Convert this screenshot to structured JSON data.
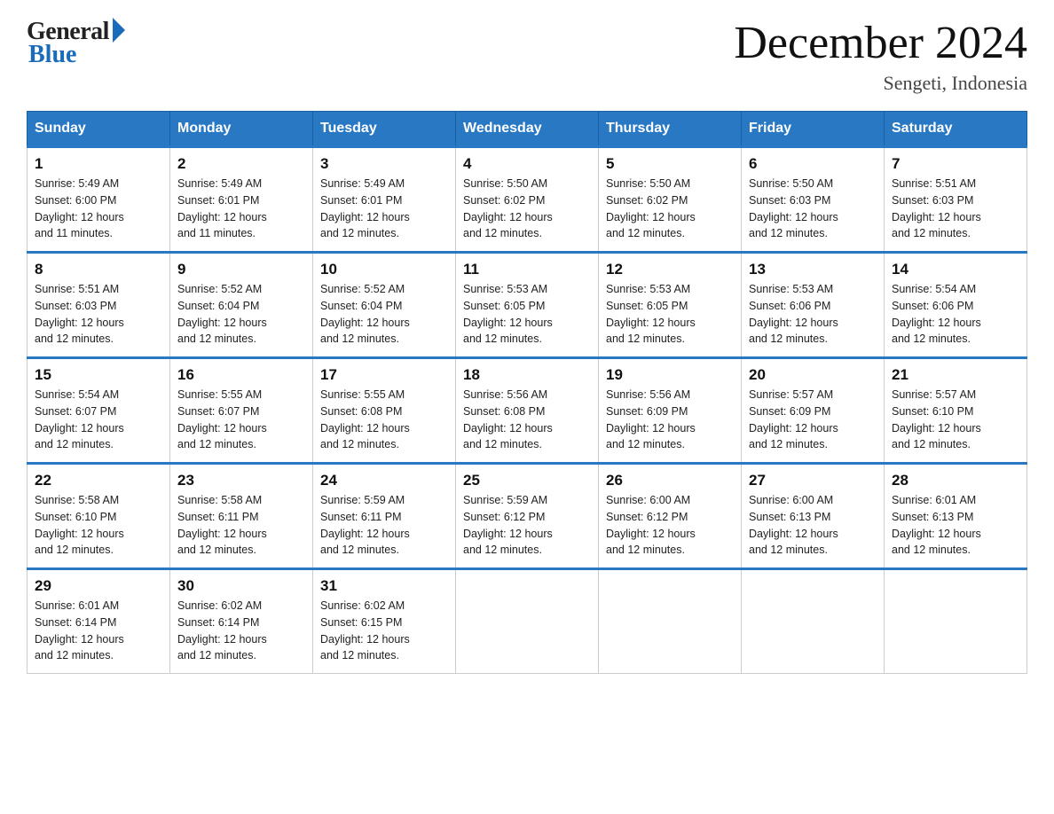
{
  "header": {
    "logo_general": "General",
    "logo_blue": "Blue",
    "month_title": "December 2024",
    "location": "Sengeti, Indonesia"
  },
  "days_of_week": [
    "Sunday",
    "Monday",
    "Tuesday",
    "Wednesday",
    "Thursday",
    "Friday",
    "Saturday"
  ],
  "weeks": [
    [
      {
        "day": "1",
        "sunrise": "5:49 AM",
        "sunset": "6:00 PM",
        "daylight": "12 hours and 11 minutes."
      },
      {
        "day": "2",
        "sunrise": "5:49 AM",
        "sunset": "6:01 PM",
        "daylight": "12 hours and 11 minutes."
      },
      {
        "day": "3",
        "sunrise": "5:49 AM",
        "sunset": "6:01 PM",
        "daylight": "12 hours and 12 minutes."
      },
      {
        "day": "4",
        "sunrise": "5:50 AM",
        "sunset": "6:02 PM",
        "daylight": "12 hours and 12 minutes."
      },
      {
        "day": "5",
        "sunrise": "5:50 AM",
        "sunset": "6:02 PM",
        "daylight": "12 hours and 12 minutes."
      },
      {
        "day": "6",
        "sunrise": "5:50 AM",
        "sunset": "6:03 PM",
        "daylight": "12 hours and 12 minutes."
      },
      {
        "day": "7",
        "sunrise": "5:51 AM",
        "sunset": "6:03 PM",
        "daylight": "12 hours and 12 minutes."
      }
    ],
    [
      {
        "day": "8",
        "sunrise": "5:51 AM",
        "sunset": "6:03 PM",
        "daylight": "12 hours and 12 minutes."
      },
      {
        "day": "9",
        "sunrise": "5:52 AM",
        "sunset": "6:04 PM",
        "daylight": "12 hours and 12 minutes."
      },
      {
        "day": "10",
        "sunrise": "5:52 AM",
        "sunset": "6:04 PM",
        "daylight": "12 hours and 12 minutes."
      },
      {
        "day": "11",
        "sunrise": "5:53 AM",
        "sunset": "6:05 PM",
        "daylight": "12 hours and 12 minutes."
      },
      {
        "day": "12",
        "sunrise": "5:53 AM",
        "sunset": "6:05 PM",
        "daylight": "12 hours and 12 minutes."
      },
      {
        "day": "13",
        "sunrise": "5:53 AM",
        "sunset": "6:06 PM",
        "daylight": "12 hours and 12 minutes."
      },
      {
        "day": "14",
        "sunrise": "5:54 AM",
        "sunset": "6:06 PM",
        "daylight": "12 hours and 12 minutes."
      }
    ],
    [
      {
        "day": "15",
        "sunrise": "5:54 AM",
        "sunset": "6:07 PM",
        "daylight": "12 hours and 12 minutes."
      },
      {
        "day": "16",
        "sunrise": "5:55 AM",
        "sunset": "6:07 PM",
        "daylight": "12 hours and 12 minutes."
      },
      {
        "day": "17",
        "sunrise": "5:55 AM",
        "sunset": "6:08 PM",
        "daylight": "12 hours and 12 minutes."
      },
      {
        "day": "18",
        "sunrise": "5:56 AM",
        "sunset": "6:08 PM",
        "daylight": "12 hours and 12 minutes."
      },
      {
        "day": "19",
        "sunrise": "5:56 AM",
        "sunset": "6:09 PM",
        "daylight": "12 hours and 12 minutes."
      },
      {
        "day": "20",
        "sunrise": "5:57 AM",
        "sunset": "6:09 PM",
        "daylight": "12 hours and 12 minutes."
      },
      {
        "day": "21",
        "sunrise": "5:57 AM",
        "sunset": "6:10 PM",
        "daylight": "12 hours and 12 minutes."
      }
    ],
    [
      {
        "day": "22",
        "sunrise": "5:58 AM",
        "sunset": "6:10 PM",
        "daylight": "12 hours and 12 minutes."
      },
      {
        "day": "23",
        "sunrise": "5:58 AM",
        "sunset": "6:11 PM",
        "daylight": "12 hours and 12 minutes."
      },
      {
        "day": "24",
        "sunrise": "5:59 AM",
        "sunset": "6:11 PM",
        "daylight": "12 hours and 12 minutes."
      },
      {
        "day": "25",
        "sunrise": "5:59 AM",
        "sunset": "6:12 PM",
        "daylight": "12 hours and 12 minutes."
      },
      {
        "day": "26",
        "sunrise": "6:00 AM",
        "sunset": "6:12 PM",
        "daylight": "12 hours and 12 minutes."
      },
      {
        "day": "27",
        "sunrise": "6:00 AM",
        "sunset": "6:13 PM",
        "daylight": "12 hours and 12 minutes."
      },
      {
        "day": "28",
        "sunrise": "6:01 AM",
        "sunset": "6:13 PM",
        "daylight": "12 hours and 12 minutes."
      }
    ],
    [
      {
        "day": "29",
        "sunrise": "6:01 AM",
        "sunset": "6:14 PM",
        "daylight": "12 hours and 12 minutes."
      },
      {
        "day": "30",
        "sunrise": "6:02 AM",
        "sunset": "6:14 PM",
        "daylight": "12 hours and 12 minutes."
      },
      {
        "day": "31",
        "sunrise": "6:02 AM",
        "sunset": "6:15 PM",
        "daylight": "12 hours and 12 minutes."
      },
      null,
      null,
      null,
      null
    ]
  ],
  "labels": {
    "sunrise": "Sunrise:",
    "sunset": "Sunset:",
    "daylight": "Daylight:"
  }
}
